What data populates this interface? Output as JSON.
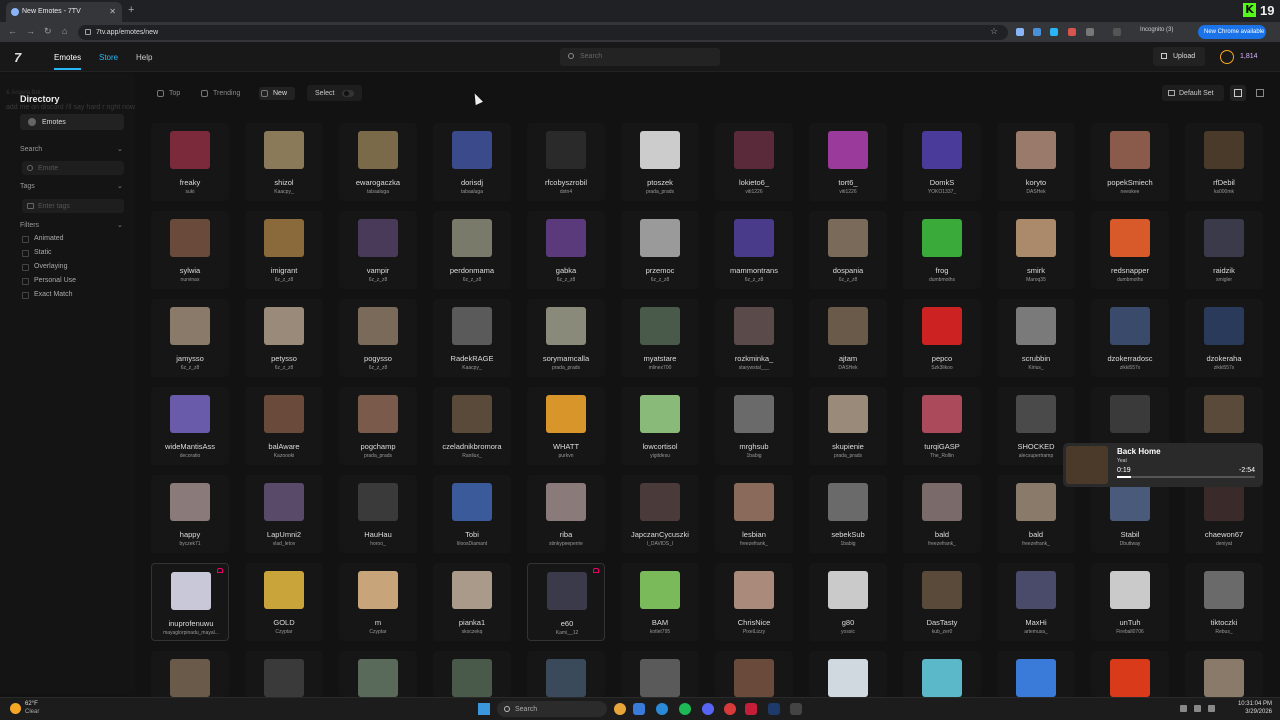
{
  "browser": {
    "tab_title": "New Emotes - 7TV",
    "new_tab": "+",
    "url": "7tv.app/emotes/new",
    "incognito": "Incognito (3)",
    "new_chrome": "New Chrome available",
    "kick_badge": "K",
    "kick_count": "19"
  },
  "header": {
    "logo": "7",
    "nav": [
      "Emotes",
      "Store",
      "Help"
    ],
    "search_placeholder": "Search",
    "upload": "Upload",
    "points": "1,814"
  },
  "sidebar": {
    "title": "Directory",
    "overlay_text": "& Angela Bot",
    "overlay_text2": "add me on discord i'll say hard r right now",
    "selected": "Emotes",
    "search_label": "Search",
    "search_placeholder": "Emote",
    "tags_label": "Tags",
    "tags_placeholder": "Enter tags",
    "filters_label": "Filters",
    "filters": [
      "Animated",
      "Static",
      "Overlaying",
      "Personal Use",
      "Exact Match"
    ]
  },
  "toolbar": {
    "top": "Top",
    "trending": "Trending",
    "new": "New",
    "select": "Select",
    "default_set": "Default Set"
  },
  "emotes": [
    {
      "name": "freaky",
      "author": "suki",
      "color": "#7a2a3a"
    },
    {
      "name": "shizol",
      "author": "Kaacpy_",
      "color": "#8a7a5a"
    },
    {
      "name": "ewarogaczka",
      "author": "tabaaluga",
      "color": "#7a6a4a"
    },
    {
      "name": "dorisdj",
      "author": "tabaaluga",
      "color": "#3a4a8a"
    },
    {
      "name": "rfcobyszrobil",
      "author": "dstn4",
      "color": "#2a2a2a"
    },
    {
      "name": "ptoszek",
      "author": "prada_prads",
      "color": "#cccccc"
    },
    {
      "name": "lokieto6_",
      "author": "viti1226",
      "color": "#5a2a3a"
    },
    {
      "name": "tort6_",
      "author": "viti1226",
      "color": "#9a3a9a"
    },
    {
      "name": "DomkS",
      "author": "YOKO1337_",
      "color": "#4a3a9a"
    },
    {
      "name": "koryto",
      "author": "DASHek",
      "color": "#9a7a6a"
    },
    {
      "name": "popekSmiech",
      "author": "neeskee",
      "color": "#8a5a4a"
    },
    {
      "name": "rfDebil",
      "author": "ks000mk",
      "color": "#4a3a2a"
    },
    {
      "name": "sylwia",
      "author": "nurvinax",
      "color": "#6a4a3a"
    },
    {
      "name": "imigrant",
      "author": "6z_z_z8",
      "color": "#8a6a3a"
    },
    {
      "name": "vampir",
      "author": "6z_z_z8",
      "color": "#4a3a5a"
    },
    {
      "name": "perdonmama",
      "author": "6z_z_z8",
      "color": "#7a7a6a"
    },
    {
      "name": "gabka",
      "author": "6z_z_z8",
      "color": "#5a3a7a"
    },
    {
      "name": "przemoc",
      "author": "6z_z_z8",
      "color": "#9a9a9a"
    },
    {
      "name": "mammontrans",
      "author": "6z_z_z8",
      "color": "#4a3a8a"
    },
    {
      "name": "dospania",
      "author": "6z_z_z8",
      "color": "#7a6a5a"
    },
    {
      "name": "frog",
      "author": "dumbmoths",
      "color": "#3aaa3a"
    },
    {
      "name": "smirk",
      "author": "Maroq35",
      "color": "#aa8a6a"
    },
    {
      "name": "redsnapper",
      "author": "dumbmoths",
      "color": "#d85a2a"
    },
    {
      "name": "raidzik",
      "author": "smigler",
      "color": "#3a3a4a"
    },
    {
      "name": "jamysso",
      "author": "6z_z_z8",
      "color": "#8a7a6a"
    },
    {
      "name": "petysso",
      "author": "6z_z_z8",
      "color": "#9a8a7a"
    },
    {
      "name": "pogysso",
      "author": "6z_z_z8",
      "color": "#7a6a5a"
    },
    {
      "name": "RadekRAGE",
      "author": "Kaacpy_",
      "color": "#5a5a5a"
    },
    {
      "name": "sorymamcalla",
      "author": "prada_prads",
      "color": "#8a8a7a"
    },
    {
      "name": "myatstare",
      "author": "mlinex700",
      "color": "#4a5a4a"
    },
    {
      "name": "rozkminka_",
      "author": "starywstal___",
      "color": "#5a4a4a"
    },
    {
      "name": "ajtam",
      "author": "DASHek",
      "color": "#6a5a4a"
    },
    {
      "name": "pepco",
      "author": "Szk3likoo",
      "color": "#cc2222"
    },
    {
      "name": "scrubbin",
      "author": "Kirius_",
      "color": "#7a7a7a"
    },
    {
      "name": "dzokerradosc",
      "author": "zikki557x",
      "color": "#3a4a6a"
    },
    {
      "name": "dzokeraha",
      "author": "zikki557x",
      "color": "#2a3a5a"
    },
    {
      "name": "wideMantisAss",
      "author": "decoratio",
      "color": "#6a5aaa"
    },
    {
      "name": "balAware",
      "author": "Kazoooki",
      "color": "#6a4a3a"
    },
    {
      "name": "pogchamp",
      "author": "prada_prads",
      "color": "#7a5a4a"
    },
    {
      "name": "czeladnikbromora",
      "author": "Ranilux_",
      "color": "#5a4a3a"
    },
    {
      "name": "WHATT",
      "author": "purkvn",
      "color": "#d8962a"
    },
    {
      "name": "lowcortisol",
      "author": "yigitdesu",
      "color": "#8aba7a"
    },
    {
      "name": "mrghsub",
      "author": "1babig",
      "color": "#6a6a6a"
    },
    {
      "name": "skupienie",
      "author": "prada_prads",
      "color": "#9a8a7a"
    },
    {
      "name": "turqiGASP",
      "author": "The_Rollin",
      "color": "#aa4a5a"
    },
    {
      "name": "SHOCKED",
      "author": "alecsupertramp",
      "color": "#4a4a4a"
    },
    {
      "name": "",
      "author": "",
      "color": "#3a3a3a"
    },
    {
      "name": "",
      "author": "",
      "color": "#5a4a3a"
    },
    {
      "name": "happy",
      "author": "byczek71",
      "color": "#8a7a7a"
    },
    {
      "name": "LapUmni2",
      "author": "vlad_letov",
      "color": "#5a4a6a"
    },
    {
      "name": "HauHau",
      "author": "horoo_",
      "color": "#3a3a3a"
    },
    {
      "name": "Tobi",
      "author": "IiloosDiamant",
      "color": "#3a5a9a"
    },
    {
      "name": "riba",
      "author": "stinkypeeperrie",
      "color": "#8a7a7a"
    },
    {
      "name": "JapczanCycuszki",
      "author": "I_DAVIDS_I",
      "color": "#4a3a3a"
    },
    {
      "name": "lesbian",
      "author": "freezefrank_",
      "color": "#8a6a5a"
    },
    {
      "name": "sebekSub",
      "author": "1babig",
      "color": "#6a6a6a"
    },
    {
      "name": "bald",
      "author": "freezefrank_",
      "color": "#7a6a6a"
    },
    {
      "name": "bald",
      "author": "freezefrank_",
      "color": "#8a7a6a"
    },
    {
      "name": "Stabil",
      "author": "Dbuttway",
      "color": "#4a5a7a"
    },
    {
      "name": "chaewon67",
      "author": "deniyat",
      "color": "#3a2a2a"
    },
    {
      "name": "inuprofenuwu",
      "author": "mayaglorpinadu_mayal...",
      "color": "#c8c8d8"
    },
    {
      "name": "GOLD",
      "author": "Czyptar",
      "color": "#c8a43a"
    },
    {
      "name": "m",
      "author": "Czyptar",
      "color": "#c8a47a"
    },
    {
      "name": "pianka1",
      "author": "skoczekq",
      "color": "#aa9a8a"
    },
    {
      "name": "e60",
      "author": "Kami__12",
      "color": "#3a3a4a"
    },
    {
      "name": "BAM",
      "author": "kotlet795",
      "color": "#7aba5a"
    },
    {
      "name": "ChrisNice",
      "author": "PixelLizzy",
      "color": "#aa8a7a"
    },
    {
      "name": "g80",
      "author": "yossic",
      "color": "#cacaca"
    },
    {
      "name": "DasTasty",
      "author": "kub_zer0",
      "color": "#5a4a3a"
    },
    {
      "name": "MaxHi",
      "author": "artemusa_",
      "color": "#4a4a6a"
    },
    {
      "name": "unTuh",
      "author": "Fireball0706",
      "color": "#cacaca"
    },
    {
      "name": "tiktoczki",
      "author": "Rebus_",
      "color": "#6a6a6a"
    }
  ],
  "bottom_row_colors": [
    "#6a5a4a",
    "#3a3a3a",
    "#5a6a5a",
    "#4a5a4a",
    "#3a4a5a",
    "#5a5a5a",
    "#6a4a3a",
    "#d0d8e0",
    "#5ab8c8",
    "#3a7ad8",
    "#d83a1a",
    "#8a7a6a"
  ],
  "media": {
    "title": "Back Home",
    "artist": "Yeat",
    "elapsed": "0:19",
    "remaining": "-2:54",
    "progress": 0.1
  },
  "taskbar": {
    "temp": "62°F",
    "condition": "Clear",
    "search": "Search",
    "time": "10:31:04 PM",
    "date": "3/29/2026"
  }
}
